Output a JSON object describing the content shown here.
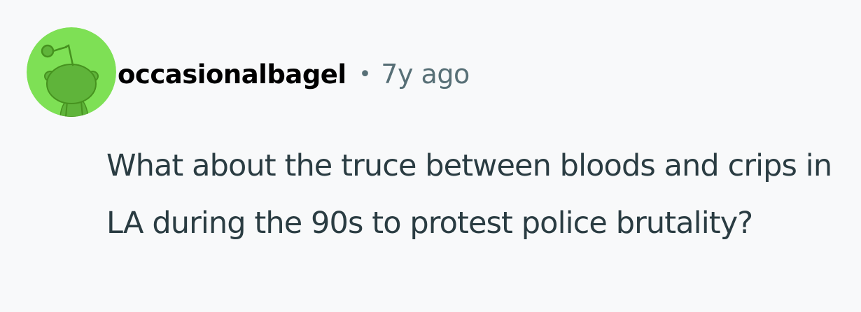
{
  "comment": {
    "avatar_icon": "reddit-snoo-avatar-icon",
    "avatar_color": "#7ee055",
    "username": "occasionalbagel",
    "separator": "•",
    "timestamp": "7y ago",
    "text": "What about the truce between bloods and crips in LA during the 90s to protest police brutality?"
  },
  "colors": {
    "background": "#f8f9fa",
    "username": "#000000",
    "meta": "#576f76",
    "body": "#2a3c42"
  }
}
